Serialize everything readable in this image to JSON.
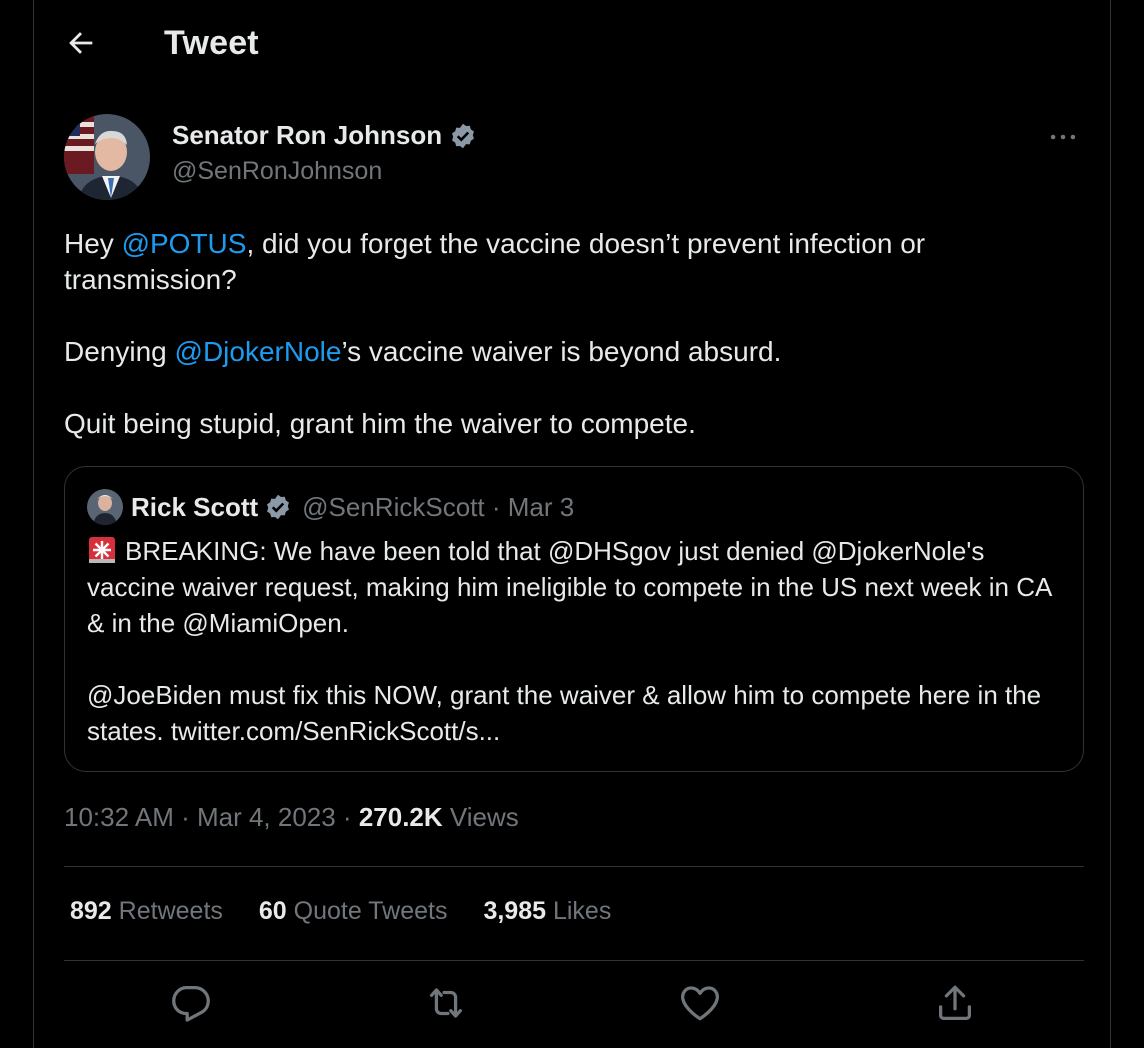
{
  "header": {
    "title": "Tweet"
  },
  "author": {
    "name": "Senator Ron Johnson",
    "handle": "@SenRonJohnson"
  },
  "tweet": {
    "line1_pre": "Hey ",
    "line1_mention": "@POTUS",
    "line1_post": ", did you forget the vaccine doesn’t prevent infection or transmission?",
    "line2_pre": "Denying ",
    "line2_mention": "@DjokerNole",
    "line2_post": "’s vaccine waiver is beyond absurd.",
    "line3": "Quit being stupid, grant him the waiver to compete."
  },
  "quote": {
    "name": "Rick Scott",
    "handle_date": "@SenRickScott · Mar 3",
    "para1": "BREAKING: We have been told that @DHSgov just denied @DjokerNole's vaccine waiver request, making him ineligible to compete in the US next week in CA & in the @MiamiOpen.",
    "para2": "@JoeBiden must fix this NOW, grant the waiver & allow him to compete here in the states. twitter.com/SenRickScott/s..."
  },
  "meta": {
    "time_date": "10:32 AM · Mar 4, 2023 · ",
    "views_count": "270.2K",
    "views_label": " Views"
  },
  "stats": {
    "retweets_count": "892",
    "retweets_label": "Retweets",
    "quotes_count": "60",
    "quotes_label": "Quote Tweets",
    "likes_count": "3,985",
    "likes_label": "Likes"
  },
  "icons": {
    "back": "arrow-left-icon",
    "more": "more-horizontal-icon",
    "verified": "verified-badge-icon",
    "siren": "siren-emoji-icon",
    "reply": "reply-icon",
    "retweet": "retweet-icon",
    "like": "heart-icon",
    "share": "share-icon"
  },
  "colors": {
    "background": "#000000",
    "text": "#e7e9ea",
    "muted": "#71767b",
    "accent": "#1d9bf0",
    "border": "#2f3336"
  }
}
